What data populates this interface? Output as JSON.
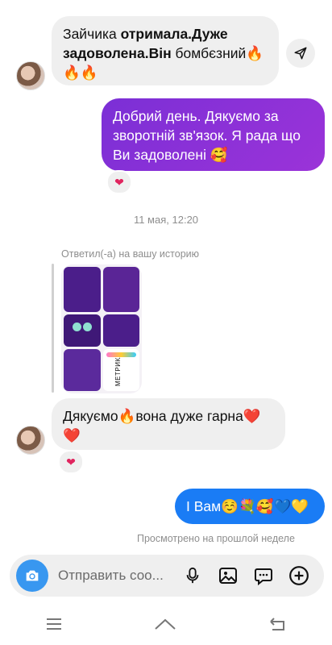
{
  "messages": {
    "m1": {
      "text_plain": "Зайчика ",
      "text_bold": "отримала.Дуже задоволена.Він",
      "text_after": " бомбєзний🔥🔥🔥"
    },
    "m2": {
      "text": "Добрий день. Дякуємо за зворотній зв'язок. Я рада що Ви задоволені 🥰",
      "reaction": "❤"
    },
    "timestamp": "11 мая, 12:20",
    "story_reply_label": "Ответил(-а) на вашу историю",
    "story": {
      "label_metrika": "МЕТРИКА"
    },
    "m3": {
      "text": "Дякуємо🔥вона дуже гарна❤️❤️",
      "reaction": "❤"
    },
    "m4": {
      "text": "І Вам☺️💐🥰💙💛"
    },
    "seen_status": "Просмотрено на прошлой неделе"
  },
  "composer": {
    "placeholder": "Отправить соо..."
  },
  "icons": {
    "camera": "camera-icon",
    "microphone": "microphone-icon",
    "gallery": "gallery-icon",
    "sticker": "sticker-icon",
    "plus": "plus-icon",
    "share": "share-icon"
  },
  "colors": {
    "accent_blue": "#3897f0",
    "outgoing_gradient_start": "#8a2be2",
    "outgoing_blue": "#1a7cf5"
  }
}
